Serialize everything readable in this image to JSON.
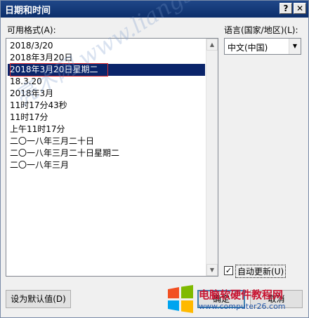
{
  "window": {
    "title": "日期和时间",
    "help_label": "?",
    "close_label": "✕"
  },
  "formats": {
    "label": "可用格式(A):",
    "items": [
      "2018/3/20",
      "2018年3月20日",
      "2018年3月20日星期二",
      "18.3.20",
      "2018年3月",
      "11时17分43秒",
      "11时17分",
      "上午11时17分",
      "二〇一八年三月二十日",
      "二〇一八年三月二十日星期二",
      "二〇一八年三月"
    ],
    "selected_index": 2
  },
  "language": {
    "label": "语言(国家/地区)(L):",
    "selected": "中文(中国)"
  },
  "auto_update": {
    "label": "自动更新(U)",
    "checked": true,
    "mark": "✓"
  },
  "buttons": {
    "set_default": "设为默认值(D)",
    "ok": "确定",
    "cancel": "取消"
  },
  "watermark": {
    "text": "亮术网 www.liangshunet.com"
  },
  "logo": {
    "title": "电脑软硬件教程网",
    "url": "www.computer26.com"
  }
}
